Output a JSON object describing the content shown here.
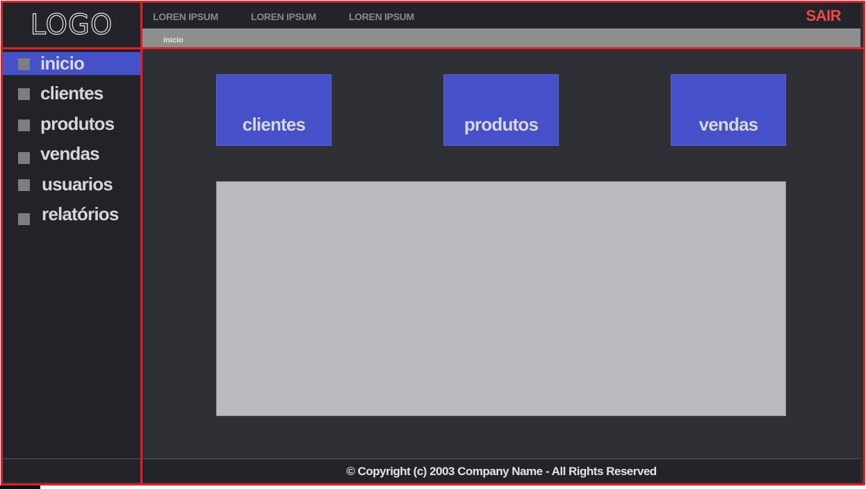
{
  "logo": {
    "text": "LOGO"
  },
  "topnav": {
    "items": [
      {
        "label": "LOREN IPSUM"
      },
      {
        "label": "LOREN IPSUM"
      },
      {
        "label": "LOREN IPSUM"
      }
    ],
    "logout_label": "SAIR"
  },
  "breadcrumb": {
    "current": "inicio"
  },
  "sidebar": {
    "items": [
      {
        "label": "inicio",
        "active": true
      },
      {
        "label": "clientes",
        "active": false
      },
      {
        "label": "produtos",
        "active": false
      },
      {
        "label": "vendas",
        "active": false
      },
      {
        "label": "usuarios",
        "active": false
      },
      {
        "label": "relatórios",
        "active": false
      }
    ]
  },
  "tiles": [
    {
      "label": "clientes"
    },
    {
      "label": "produtos"
    },
    {
      "label": "vendas"
    }
  ],
  "footer": {
    "copyright": "© Copyright (c) 2003 Company Name - All Rights Reserved"
  },
  "colors": {
    "accent": "#4650c8",
    "border": "#e0202a",
    "logout": "#f04848",
    "background": "#2f3036",
    "sidebar": "#222328",
    "panel": "#b9babd"
  }
}
